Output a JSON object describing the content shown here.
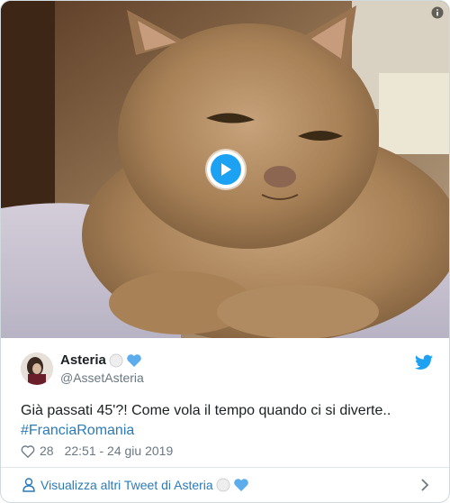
{
  "tweet": {
    "media": {
      "play_icon": "play-icon",
      "gif_icon": "info-icon"
    },
    "author": {
      "display_name": "Asteria",
      "handle": "@AssetAsteria",
      "name_emojis": [
        "white-circle-icon",
        "blue-heart-icon"
      ]
    },
    "text": "Già passati 45'?! Come vola il tempo quando ci si diverte..",
    "hashtag": "#FranciaRomania",
    "likes": "28",
    "timestamp": "22:51 - 24 giu 2019",
    "more_tweets_label": "Visualizza altri Tweet di Asteria"
  },
  "colors": {
    "link": "#2b7bb9",
    "twitter_blue": "#1da1f2",
    "muted": "#697882",
    "text": "#1c2022",
    "border": "#cfd9de"
  }
}
